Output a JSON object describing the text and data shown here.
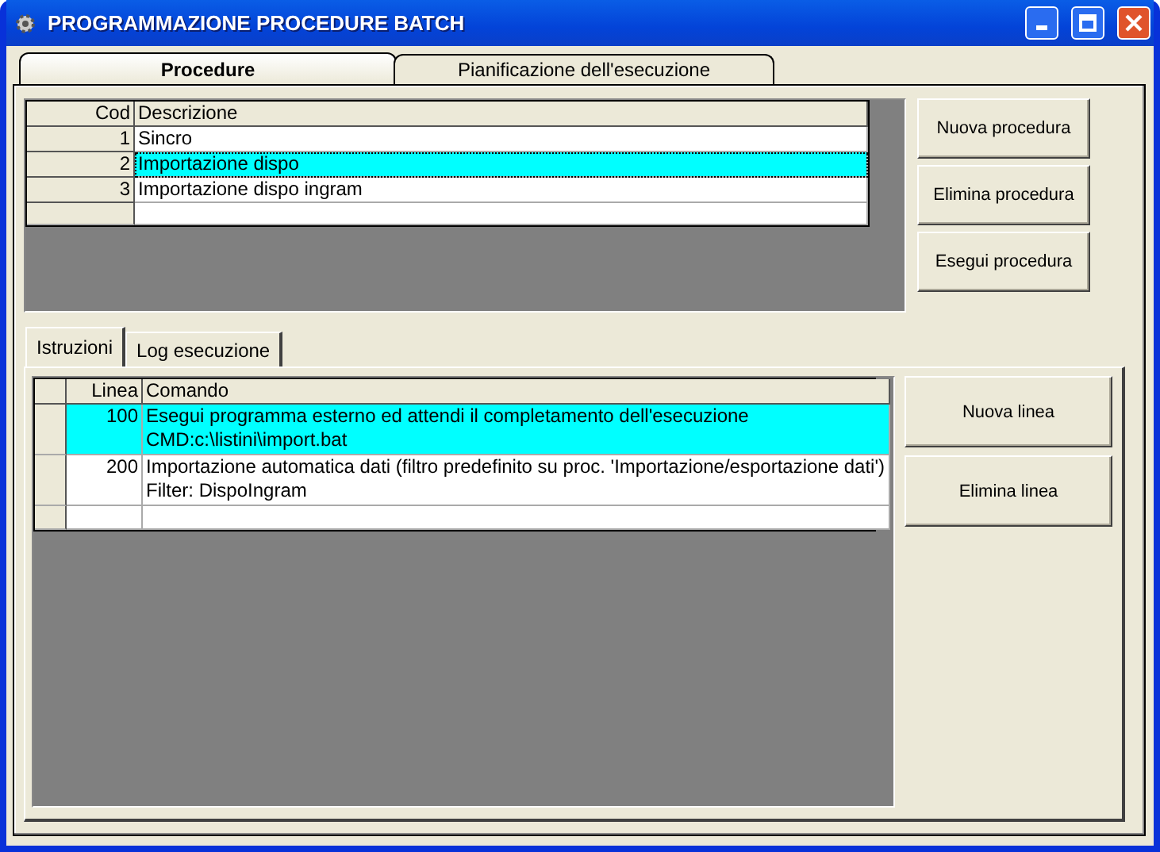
{
  "window": {
    "title": "PROGRAMMAZIONE PROCEDURE BATCH"
  },
  "tabs": [
    {
      "label": "Procedure",
      "selected": true
    },
    {
      "label": "Pianificazione dell'esecuzione",
      "selected": false
    }
  ],
  "procedures": {
    "columns": [
      "Cod",
      "Descrizione"
    ],
    "rows": [
      {
        "cod": "1",
        "descrizione": "Sincro",
        "selected": false
      },
      {
        "cod": "2",
        "descrizione": "Importazione dispo",
        "selected": true
      },
      {
        "cod": "3",
        "descrizione": "Importazione dispo ingram",
        "selected": false
      }
    ]
  },
  "procedure_buttons": [
    "Nuova procedura",
    "Elimina procedura",
    "Esegui procedura"
  ],
  "subtabs": [
    {
      "label": "Istruzioni",
      "selected": true
    },
    {
      "label": "Log esecuzione",
      "selected": false
    }
  ],
  "instructions": {
    "columns": [
      "Linea",
      "Comando"
    ],
    "rows": [
      {
        "linea": "100",
        "comando": [
          "Esegui programma esterno ed attendi il completamento dell'esecuzione",
          "CMD:c:\\listini\\import.bat"
        ],
        "selected": true
      },
      {
        "linea": "200",
        "comando": [
          "Importazione automatica dati (filtro predefinito su proc. 'Importazione/esportazione dati')",
          "Filter: DispoIngram"
        ],
        "selected": false
      }
    ]
  },
  "line_buttons": [
    "Nuova linea",
    "Elimina linea"
  ]
}
